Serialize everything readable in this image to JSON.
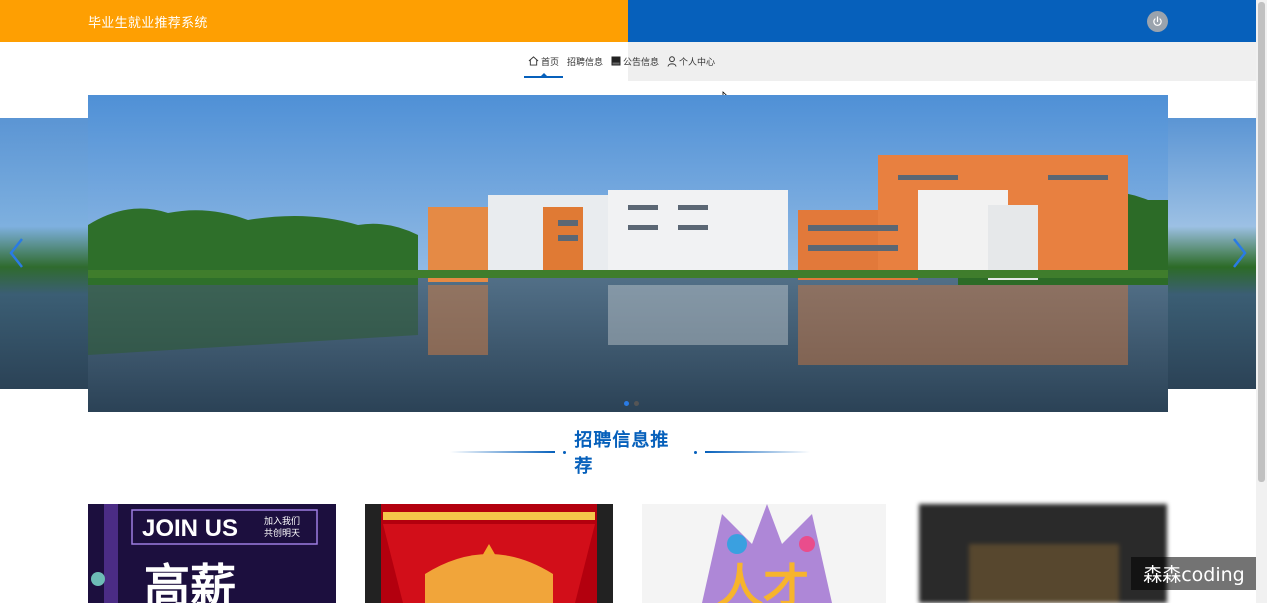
{
  "header": {
    "title": "毕业生就业推荐系统",
    "left_color": "#fe9f02",
    "right_color": "#0660bb",
    "power_icon": "power-icon"
  },
  "nav": {
    "items": [
      {
        "label": "首页",
        "icon": "home-icon",
        "active": true
      },
      {
        "label": "招聘信息",
        "icon": "",
        "active": false
      },
      {
        "label": "公告信息",
        "icon": "notice-icon",
        "active": false
      },
      {
        "label": "个人中心",
        "icon": "user-icon",
        "active": false
      }
    ]
  },
  "carousel": {
    "prev_icon": "chevron-left-icon",
    "next_icon": "chevron-right-icon",
    "slide_count": 2,
    "active_index": 0
  },
  "section": {
    "title": "招聘信息推荐"
  },
  "cards": [
    {
      "text_main": "JOIN US",
      "text_side": "加入我们\n共创明天",
      "text_big": "高薪"
    },
    {
      "text_big": ""
    },
    {
      "text_big": "人才"
    },
    {
      "text_big": ""
    }
  ],
  "watermark": "森森coding"
}
